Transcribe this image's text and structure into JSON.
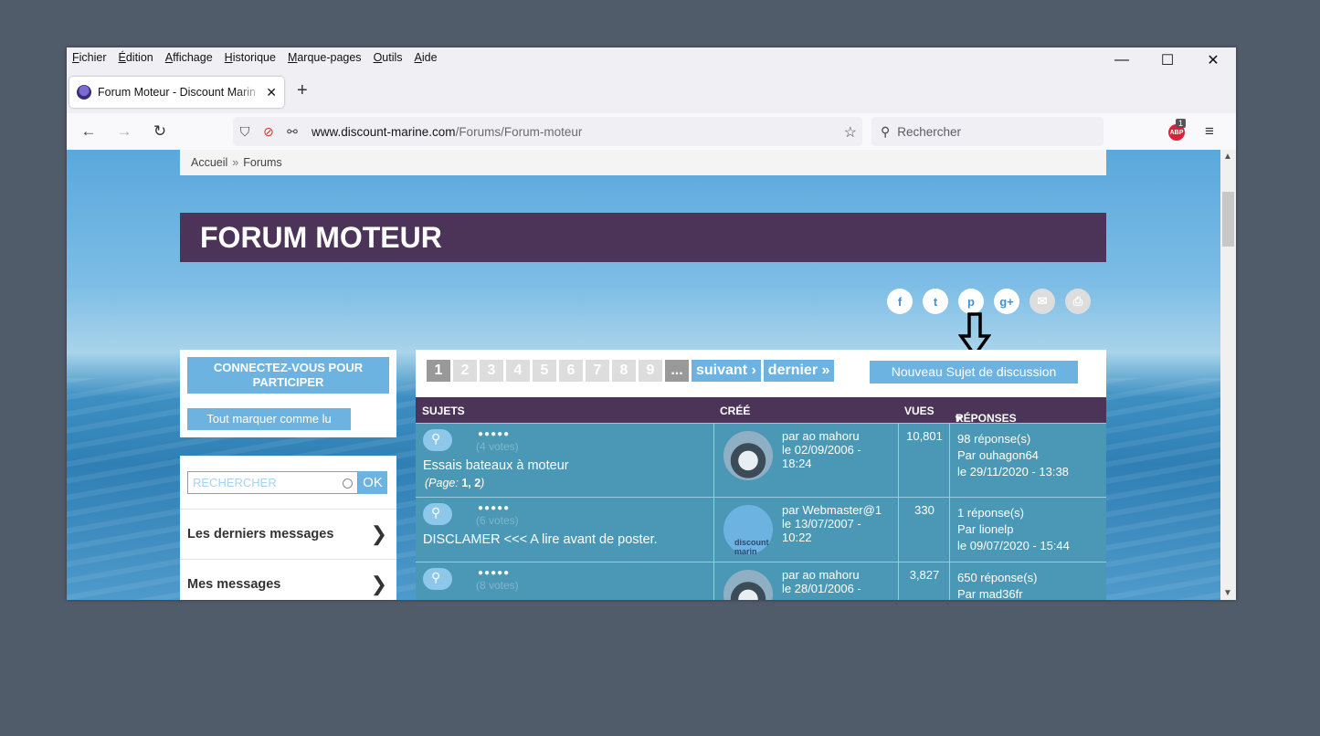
{
  "menu": [
    "Fichier",
    "Édition",
    "Affichage",
    "Historique",
    "Marque-pages",
    "Outils",
    "Aide"
  ],
  "window_controls": {
    "minimize": "—",
    "maximize": "☐",
    "close": "✕"
  },
  "tab": {
    "title": "Forum Moteur - Discount Marin",
    "close": "✕",
    "new_tab": "+"
  },
  "nav": {
    "back": "←",
    "forward": "→",
    "reload": "↻"
  },
  "url": {
    "domain": "www.discount-marine.com",
    "path": "/Forums/Forum-moteur"
  },
  "search": {
    "placeholder": "Rechercher"
  },
  "abp": {
    "label": "ABP",
    "count": "1"
  },
  "breadcrumb": {
    "home": "Accueil",
    "sep": "»",
    "current": "Forums"
  },
  "page_title": "FORUM MOTEUR",
  "social": [
    "f",
    "t",
    "p",
    "g+",
    "✉",
    "⎙"
  ],
  "left": {
    "connect": "CONNECTEZ-VOUS POUR PARTICIPER",
    "mark_read": "Tout marquer comme lu",
    "search_placeholder": "RECHERCHER",
    "ok": "OK",
    "links": [
      "Les derniers messages",
      "Mes messages"
    ]
  },
  "pager": {
    "pages": [
      "1",
      "2",
      "3",
      "4",
      "5",
      "6",
      "7",
      "8",
      "9",
      "..."
    ],
    "next": "suivant ›",
    "last": "dernier »"
  },
  "new_topic": "Nouveau Sujet de discussion",
  "table": {
    "headers": {
      "subjects": "SUJETS",
      "created": "CRÉÉ",
      "views": "VUES",
      "replies": "RÉPONSES"
    },
    "rows": [
      {
        "votes": "(4 votes)",
        "title": "Essais bateaux à moteur",
        "pages_label": "(Page: ",
        "pages": "1, 2",
        "pages_end": ")",
        "author": "par ao mahoru",
        "date": "le 02/09/2006 -",
        "time": "18:24",
        "views": "10,801",
        "replies": "98 réponse(s)",
        "by": "Par ouhagon64",
        "last": "le 29/11/2020 - 13:38"
      },
      {
        "votes": "(6 votes)",
        "title": "DISCLAMER <<< A lire avant de poster.",
        "author": "par Webmaster@1",
        "date": "le 13/07/2007 -",
        "time": "10:22",
        "views": "330",
        "replies": "1 réponse(s)",
        "by": "Par lionelp",
        "last": "le 09/07/2020 - 15:44",
        "logo": "discount marin"
      },
      {
        "votes": "(8 votes)",
        "author": "par ao mahoru",
        "date": "le 28/01/2006 -",
        "views": "3,827",
        "replies": "650 réponse(s)",
        "by": "Par mad36fr"
      }
    ]
  },
  "stars": "●●●●●",
  "icons": {
    "shield": "shield-icon",
    "star": "bookmark-star-icon",
    "menu": "hamburger-icon"
  }
}
